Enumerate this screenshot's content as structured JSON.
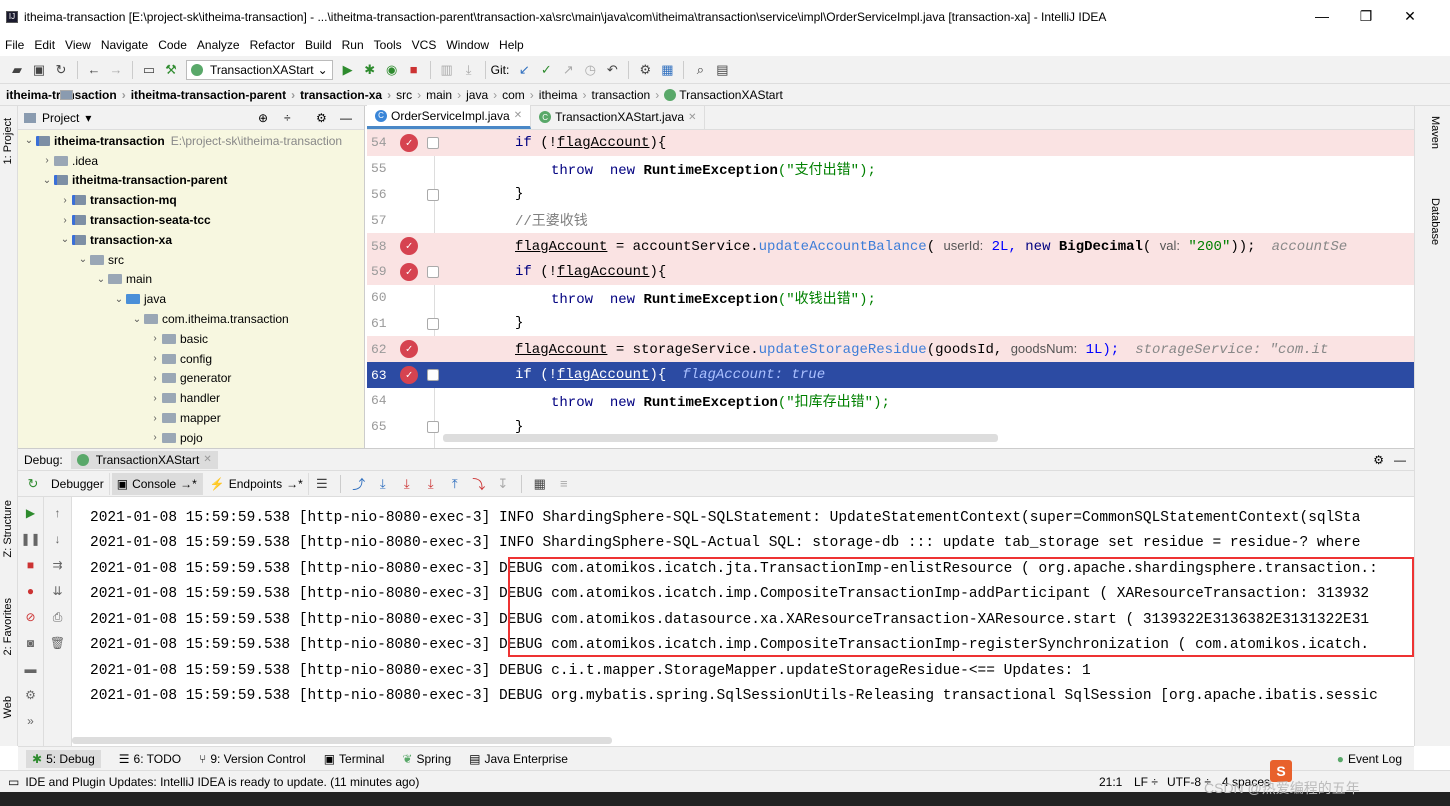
{
  "window": {
    "title": "itheima-transaction [E:\\project-sk\\itheima-transaction] - ...\\itheitma-transaction-parent\\transaction-xa\\src\\main\\java\\com\\itheima\\transaction\\service\\impl\\OrderServiceImpl.java [transaction-xa] - IntelliJ IDEA",
    "minimize": "—",
    "restore": "❐",
    "close": "✕"
  },
  "menu": [
    "File",
    "Edit",
    "View",
    "Navigate",
    "Code",
    "Analyze",
    "Refactor",
    "Build",
    "Run",
    "Tools",
    "VCS",
    "Window",
    "Help"
  ],
  "toolbar": {
    "run_config": "TransactionXAStart",
    "git_label": "Git:"
  },
  "breadcrumbs": [
    "itheima-transaction",
    "itheitma-transaction-parent",
    "transaction-xa",
    "src",
    "main",
    "java",
    "com",
    "itheima",
    "transaction",
    "TransactionXAStart"
  ],
  "left_strip": {
    "project_tab": "1: Project",
    "structure_tab": "Z: Structure",
    "favorites_tab": "2: Favorites",
    "web_tab": "Web"
  },
  "right_strip": {
    "maven_tab": "Maven",
    "database_tab": "Database"
  },
  "project": {
    "header": "Project",
    "tree": [
      {
        "label": "itheima-transaction",
        "extra": "E:\\project-sk\\itheima-transaction"
      },
      {
        "label": ".idea"
      },
      {
        "label": "itheitma-transaction-parent"
      },
      {
        "label": "transaction-mq"
      },
      {
        "label": "transaction-seata-tcc"
      },
      {
        "label": "transaction-xa"
      },
      {
        "label": "src"
      },
      {
        "label": "main"
      },
      {
        "label": "java"
      },
      {
        "label": "com.itheima.transaction"
      },
      {
        "label": "basic"
      },
      {
        "label": "config"
      },
      {
        "label": "generator"
      },
      {
        "label": "handler"
      },
      {
        "label": "mapper"
      },
      {
        "label": "pojo"
      }
    ]
  },
  "editor": {
    "tabs": [
      {
        "label": "OrderServiceImpl.java"
      },
      {
        "label": "TransactionXAStart.java"
      }
    ],
    "line_numbers": [
      "54",
      "55",
      "56",
      "57",
      "58",
      "59",
      "60",
      "61",
      "62",
      "63",
      "64",
      "65"
    ],
    "lines": {
      "l54": {
        "kw": "if",
        "open": " (!",
        "var": "flagAccount",
        "close": "){"
      },
      "l55": {
        "throw": "throw",
        "new": "new",
        "cls": "RuntimeException",
        "str": "(\"支付出错\");"
      },
      "l56": {
        "text": "}"
      },
      "l57": {
        "comment": "//王婆收钱"
      },
      "l58": {
        "var": "flagAccount",
        "eq": " = accountService.",
        "method": "updateAccountBalance",
        "p1": "( ",
        "hint1": "userId:",
        "v1": " 2L, ",
        "new": "new",
        "cls": "BigDecimal",
        "p2": "( ",
        "hint2": "val:",
        "s2": " \"200\"",
        "end": "));",
        "inline": "accountSe"
      },
      "l59": {
        "kw": "if",
        "open": " (!",
        "var": "flagAccount",
        "close": "){"
      },
      "l60": {
        "throw": "throw",
        "new": "new",
        "cls": "RuntimeException",
        "str": "(\"收钱出错\");"
      },
      "l61": {
        "text": "}"
      },
      "l62": {
        "var": "flagAccount",
        "eq": " = storageService.",
        "method": "updateStorageResidue",
        "p1": "(goodsId, ",
        "hint1": "goodsNum:",
        "v1": " 1L);",
        "inline": "storageService: \"com.it"
      },
      "l63": {
        "kw": "if",
        "open": " (!",
        "var": "flagAccount",
        "close": "){",
        "inline": "flagAccount: true"
      },
      "l64": {
        "throw": "throw",
        "new": "new",
        "cls": "RuntimeException",
        "str": "(\"扣库存出错\");"
      },
      "l65": {
        "text": "}"
      }
    }
  },
  "debug": {
    "label": "Debug:",
    "session_tab": "TransactionXAStart",
    "tabs": {
      "debugger": "Debugger",
      "console": "Console",
      "endpoints": "Endpoints"
    },
    "log": [
      "2021-01-08 15:59:59.538 [http-nio-8080-exec-3] INFO  ShardingSphere-SQL-SQLStatement: UpdateStatementContext(super=CommonSQLStatementContext(sqlSta",
      "2021-01-08 15:59:59.538 [http-nio-8080-exec-3] INFO  ShardingSphere-SQL-Actual SQL: storage-db ::: update tab_storage set residue = residue-? where",
      "2021-01-08 15:59:59.538 [http-nio-8080-exec-3] DEBUG com.atomikos.icatch.jta.TransactionImp-enlistResource ( org.apache.shardingsphere.transaction.:",
      "2021-01-08 15:59:59.538 [http-nio-8080-exec-3] DEBUG com.atomikos.icatch.imp.CompositeTransactionImp-addParticipant ( XAResourceTransaction: 313932",
      "2021-01-08 15:59:59.538 [http-nio-8080-exec-3] DEBUG com.atomikos.datasource.xa.XAResourceTransaction-XAResource.start ( 3139322E3136382E3131322E31",
      "2021-01-08 15:59:59.538 [http-nio-8080-exec-3] DEBUG com.atomikos.icatch.imp.CompositeTransactionImp-registerSynchronization ( com.atomikos.icatch.",
      "2021-01-08 15:59:59.538 [http-nio-8080-exec-3] DEBUG c.i.t.mapper.StorageMapper.updateStorageResidue-<==    Updates: 1",
      "2021-01-08 15:59:59.538 [http-nio-8080-exec-3] DEBUG org.mybatis.spring.SqlSessionUtils-Releasing transactional SqlSession [org.apache.ibatis.sessic"
    ]
  },
  "bottom_tabs": [
    "5: Debug",
    "6: TODO",
    "9: Version Control",
    "Terminal",
    "Spring",
    "Java Enterprise"
  ],
  "event_log": "Event Log",
  "status": {
    "message": "IDE and Plugin Updates: IntelliJ IDEA is ready to update. (11 minutes ago)",
    "position": "21:1",
    "line_sep": "LF ÷",
    "encoding": "UTF-8 ÷",
    "indent": "4 spaces"
  },
  "watermark": "CSDN @热爱编程的五年"
}
